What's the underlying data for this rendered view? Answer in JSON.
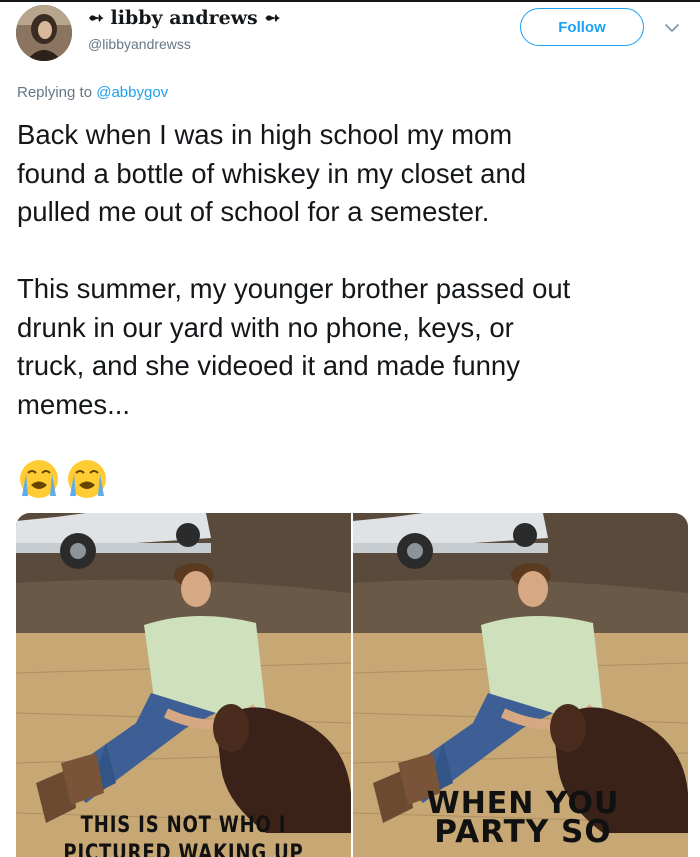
{
  "author": {
    "display_name": "➻ libby andrews ➻",
    "handle": "@libbyandrewss"
  },
  "follow_label": "Follow",
  "reply": {
    "prefix": "Replying to",
    "mention": "@abbygov"
  },
  "tweet_text": "Back when I was in high school my mom\nfound a bottle of whiskey in my closet and\npulled me out of school for a semester.\n\nThis summer, my younger brother passed out\ndrunk in our yard with no phone, keys, or\ntruck, and she videoed it and made funny\nmemes...",
  "emojis": [
    "loudly-crying-face",
    "loudly-crying-face"
  ],
  "media": {
    "left_caption": [
      "THIS IS NOT WHO I",
      "PICTURED WAKING UP"
    ],
    "right_caption": [
      "WHEN YOU",
      "PARTY SO"
    ]
  },
  "colors": {
    "accent": "#1da1f2",
    "text": "#14171a",
    "secondary": "#657786"
  }
}
